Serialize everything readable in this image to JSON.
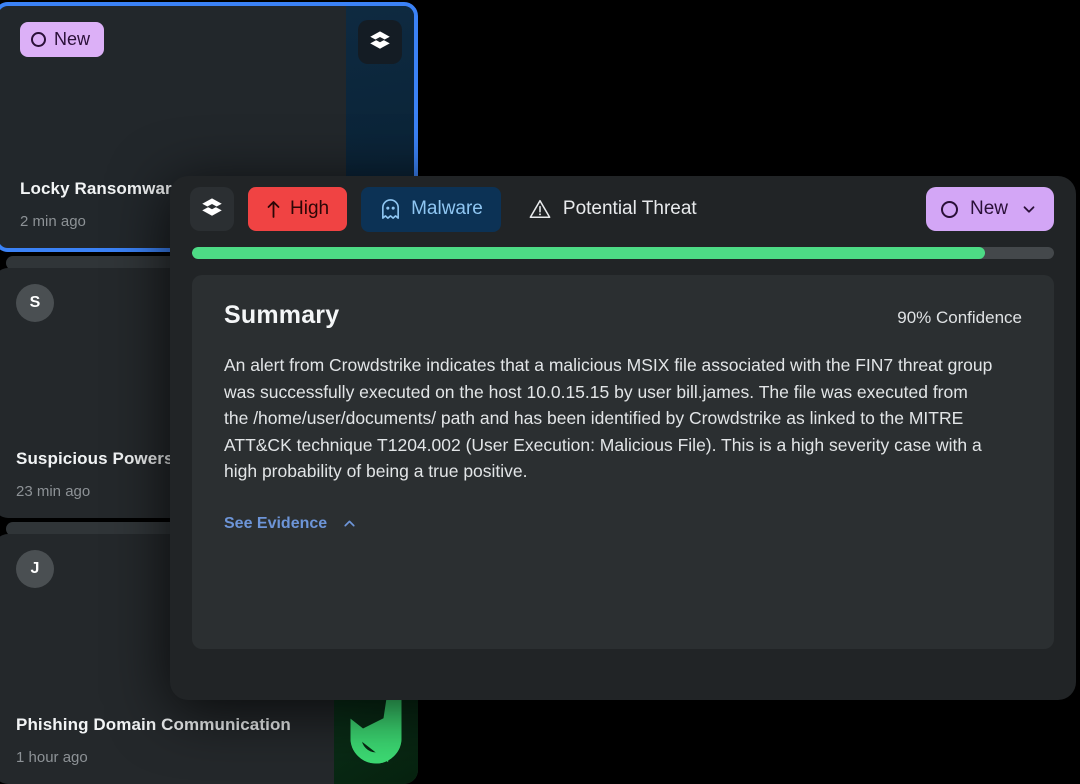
{
  "alert_list": {
    "cards": [
      {
        "id": "locky",
        "badge_label": "New",
        "badge_icon": "circle-outline-icon",
        "title": "Locky Ransomware Execution",
        "time": "2 min ago",
        "art": "soc-hexagon-blue",
        "selected": true
      },
      {
        "id": "powershell",
        "avatar": "S",
        "title": "Suspicious Powershell",
        "time": "23 min ago",
        "art": "green-gradient",
        "selected": false
      },
      {
        "id": "phishing",
        "avatar": "J",
        "title": "Phishing Domain Communication",
        "time": "1 hour ago",
        "art": "fish-hook-green",
        "selected": false
      }
    ]
  },
  "modal": {
    "header": {
      "logo_icon": "hexagon-layers-icon",
      "severity": {
        "label": "High",
        "icon": "arrow-up-icon",
        "color": "#f04343"
      },
      "category": {
        "label": "Malware",
        "icon": "ghost-icon",
        "color": "#0c3255"
      },
      "verdict": {
        "label": "Potential Threat",
        "icon": "warning-triangle-icon"
      },
      "status": {
        "label": "New",
        "icon": "circle-outline-icon",
        "chevron": "chevron-down-icon",
        "color": "#d3a6f6"
      }
    },
    "progress": {
      "percent": 92,
      "color": "#4ddb85"
    },
    "summary": {
      "title": "Summary",
      "confidence": "90% Confidence",
      "body": "An alert from Crowdstrike indicates that a malicious MSIX file associated with the FIN7 threat group was successfully executed on the host 10.0.15.15 by user bill.james. The file was executed from the /home/user/documents/ path and has been identified by Crowdstrike as linked to the MITRE ATT&CK technique T1204.002 (User Execution: Malicious File). This is a high severity case with a high probability of being a true positive.",
      "evidence_link": "See Evidence",
      "evidence_chevron": "chevron-up-icon"
    }
  }
}
